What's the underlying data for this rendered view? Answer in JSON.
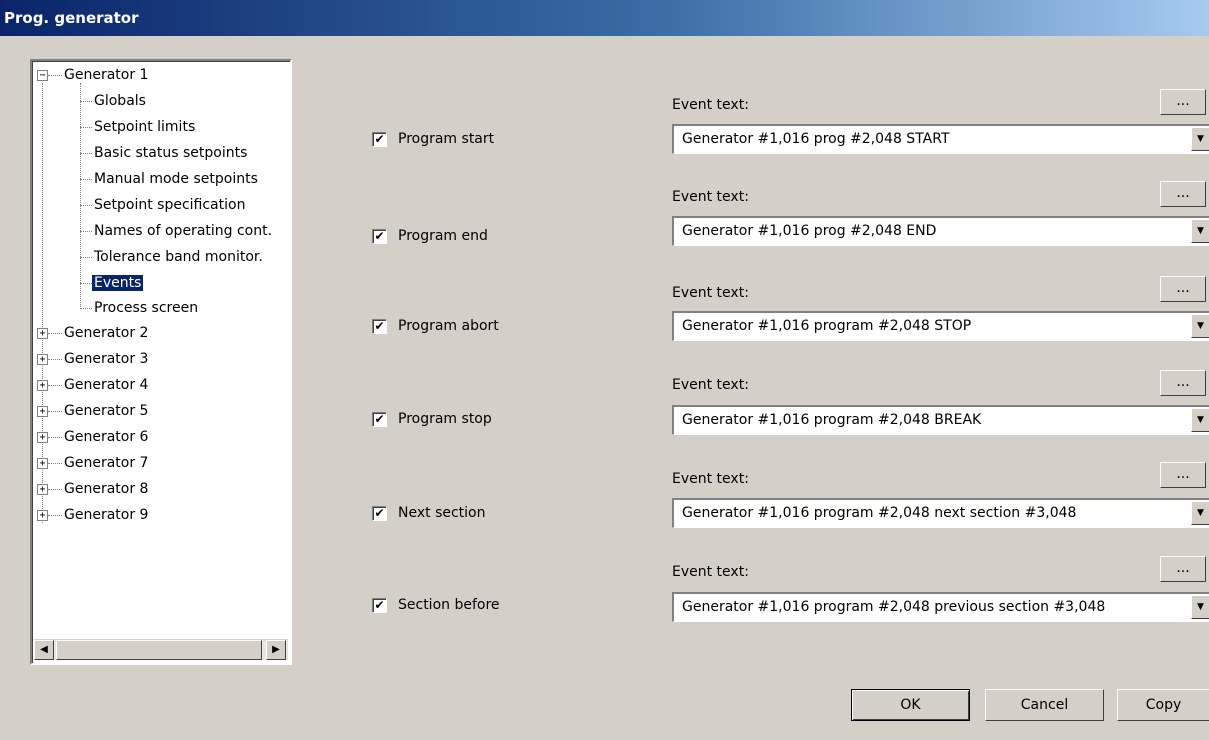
{
  "window": {
    "title": "Prog. generator"
  },
  "tree": {
    "root": {
      "label": "Generator 1",
      "expander": "−",
      "children": [
        {
          "label": "Globals"
        },
        {
          "label": "Setpoint limits"
        },
        {
          "label": "Basic status setpoints"
        },
        {
          "label": "Manual mode setpoints"
        },
        {
          "label": "Setpoint specification"
        },
        {
          "label": "Names of operating cont."
        },
        {
          "label": "Tolerance band monitor."
        },
        {
          "label": "Events"
        },
        {
          "label": "Process screen"
        }
      ]
    },
    "collapsed": [
      {
        "label": "Generator 2"
      },
      {
        "label": "Generator 3"
      },
      {
        "label": "Generator 4"
      },
      {
        "label": "Generator 5"
      },
      {
        "label": "Generator 6"
      },
      {
        "label": "Generator 7"
      },
      {
        "label": "Generator 8"
      },
      {
        "label": "Generator 9"
      }
    ],
    "plus": "+",
    "selected": "Events",
    "scroll_left": "◀",
    "scroll_right": "▶"
  },
  "events": [
    {
      "checkbox_label": "Program start",
      "checked": true,
      "event_text_label": "Event text:",
      "value": "Generator #1,016 prog #2,048 START",
      "dots": "..."
    },
    {
      "checkbox_label": "Program end",
      "checked": true,
      "event_text_label": "Event text:",
      "value": "Generator #1,016 prog #2,048 END",
      "dots": "..."
    },
    {
      "checkbox_label": "Program abort",
      "checked": true,
      "event_text_label": "Event text:",
      "value": "Generator #1,016 program #2,048 STOP",
      "dots": "..."
    },
    {
      "checkbox_label": "Program stop",
      "checked": true,
      "event_text_label": "Event text:",
      "value": "Generator #1,016 program #2,048 BREAK",
      "dots": "..."
    },
    {
      "checkbox_label": "Next section",
      "checked": true,
      "event_text_label": "Event text:",
      "value": "Generator #1,016 program #2,048 next section #3,048",
      "dots": "..."
    },
    {
      "checkbox_label": "Section before",
      "checked": true,
      "event_text_label": "Event text:",
      "value": "Generator #1,016 program #2,048 previous section #3,048",
      "dots": "..."
    }
  ],
  "checkmark": "✔",
  "dropdown_arrow": "▼",
  "buttons": {
    "ok": "OK",
    "cancel": "Cancel",
    "copy": "Copy"
  }
}
